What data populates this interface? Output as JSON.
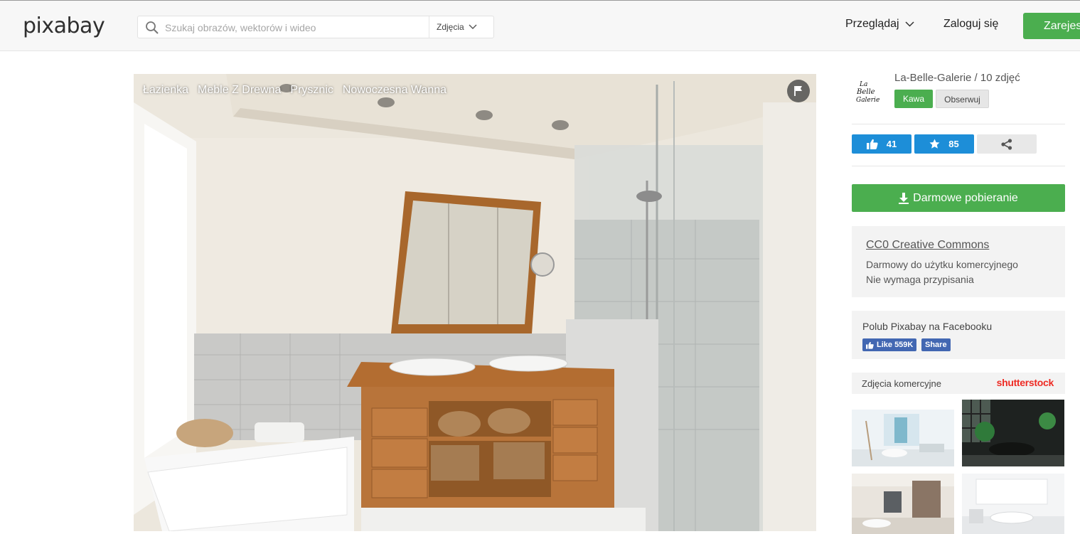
{
  "header": {
    "logo": "pixabay",
    "search_placeholder": "Szukaj obrazów, wektorów i wideo",
    "search_type": "Zdjęcia",
    "browse_label": "Przeglądaj",
    "login_label": "Zaloguj się",
    "register_label": "Zarejestruj się"
  },
  "photo": {
    "tags": [
      "Łazienka",
      "Meble Z Drewna",
      "Prysznic",
      "Nowoczesna Wanna"
    ]
  },
  "author": {
    "avatar_text": "La Belle Galerie",
    "name_line": "La-Belle-Galerie / 10 zdjęć",
    "coffee_label": "Kawa",
    "follow_label": "Obserwuj"
  },
  "stats": {
    "likes": "41",
    "favorites": "85"
  },
  "download": {
    "label": "Darmowe pobieranie"
  },
  "license": {
    "title": "CC0 Creative Commons",
    "line1": "Darmowy do użytku komercyjnego",
    "line2": "Nie wymaga przypisania"
  },
  "facebook": {
    "text": "Polub Pixabay na Facebooku",
    "like_label": "Like 559K",
    "share_label": "Share"
  },
  "commercial": {
    "label": "Zdjęcia komercyjne",
    "brand": "shutterstock"
  },
  "colors": {
    "green": "#4bae4f",
    "blue": "#1d8ed8",
    "facebook": "#4267b2",
    "shutterstock": "#ee2b24"
  }
}
